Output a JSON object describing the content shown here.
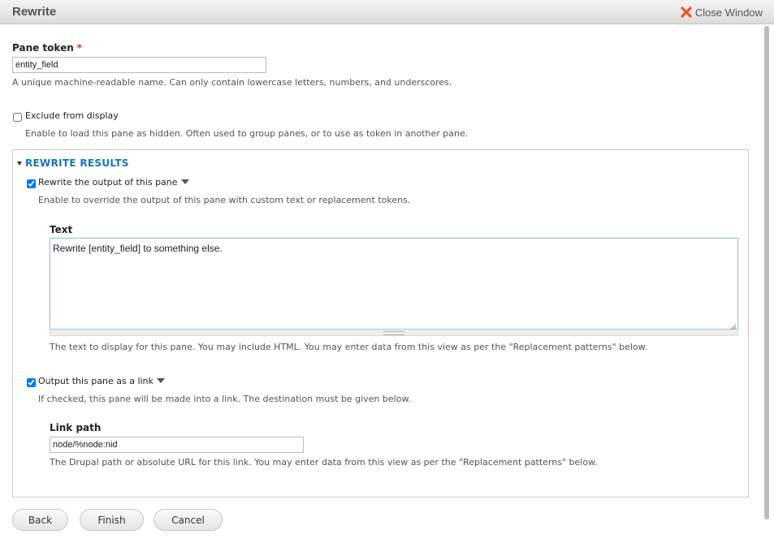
{
  "window": {
    "title": "Rewrite",
    "close_label": "Close Window"
  },
  "pane_token": {
    "label": "Pane token",
    "required_marker": "*",
    "value": "entity_field",
    "description": "A unique machine-readable name. Can only contain lowercase letters, numbers, and underscores."
  },
  "exclude": {
    "label": "Exclude from display",
    "checked": false,
    "description": "Enable to load this pane as hidden. Often used to group panes, or to use as token in another pane."
  },
  "rewrite_results": {
    "legend": "REWRITE RESULTS",
    "rewrite_output": {
      "label": "Rewrite the output of this pane",
      "checked": true,
      "description": "Enable to override the output of this pane with custom text or replacement tokens."
    },
    "text": {
      "label": "Text",
      "value": "Rewrite [entity_field] to something else.",
      "description": "The text to display for this pane. You may include HTML. You may enter data from this view as per the \"Replacement patterns\" below."
    },
    "output_link": {
      "label": "Output this pane as a link",
      "checked": true,
      "description": "If checked, this pane will be made into a link. The destination must be given below."
    },
    "link_path": {
      "label": "Link path",
      "value": "node/%node:nid",
      "description": "The Drupal path or absolute URL for this link. You may enter data from this view as per the \"Replacement patterns\" below."
    }
  },
  "buttons": {
    "back": "Back",
    "finish": "Finish",
    "cancel": "Cancel"
  },
  "colors": {
    "accent_link": "#1a73b8",
    "close_icon": "#e8562a",
    "required": "#e0302d"
  }
}
